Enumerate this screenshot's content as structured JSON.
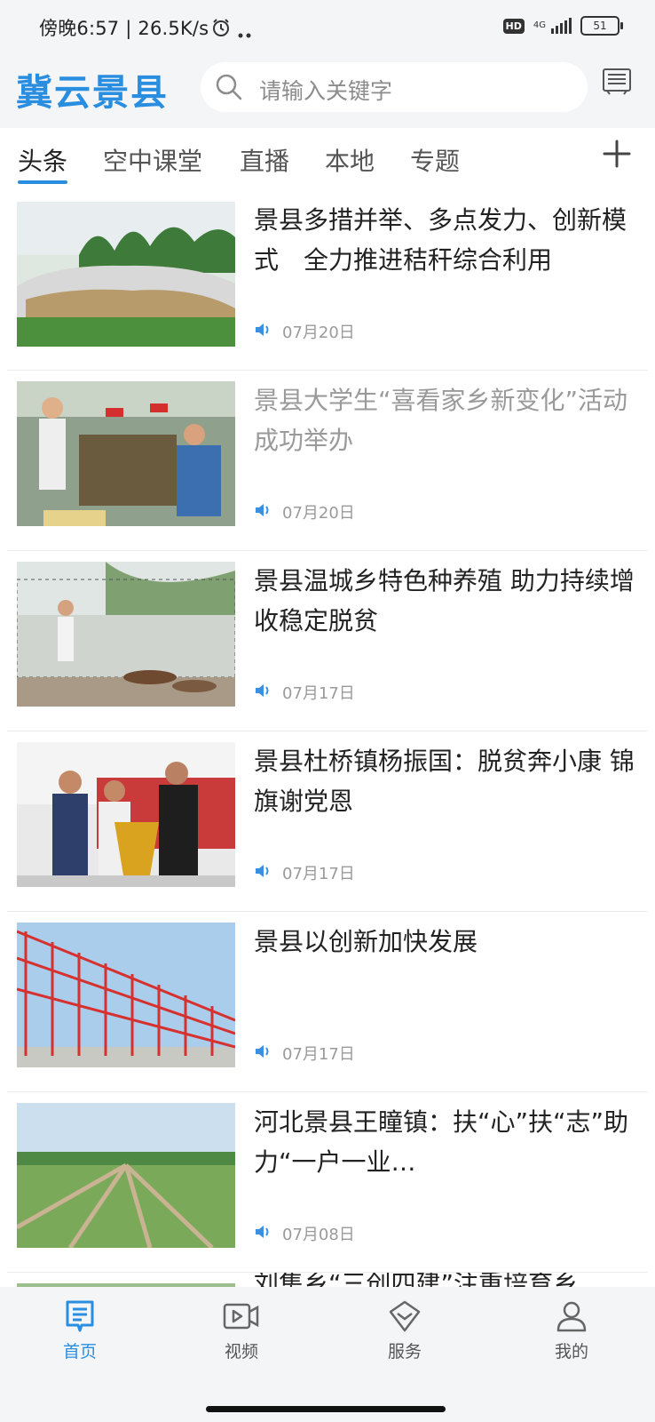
{
  "status_bar": {
    "time_text": "傍晚6:57 | 26.5K/s",
    "hd_label": "HD",
    "network_label": "4G",
    "battery_level": "51"
  },
  "header": {
    "app_title": "冀云景县",
    "search_placeholder": "请输入关键字"
  },
  "tabs": [
    {
      "label": "头条",
      "active": true
    },
    {
      "label": "空中课堂",
      "active": false
    },
    {
      "label": "直播",
      "active": false
    },
    {
      "label": "本地",
      "active": false
    },
    {
      "label": "专题",
      "active": false
    }
  ],
  "news": [
    {
      "title": "景县多措并举、多点发力、创新模式　全力推进秸秆综合利用",
      "date": "07月20日",
      "read": false
    },
    {
      "title": "景县大学生“喜看家乡新变化”活动成功举办",
      "date": "07月20日",
      "read": true
    },
    {
      "title": "景县温城乡特色种养殖 助力持续增收稳定脱贫",
      "date": "07月17日",
      "read": false
    },
    {
      "title": "景县杜桥镇杨振国：脱贫奔小康 锦旗谢党恩",
      "date": "07月17日",
      "read": false
    },
    {
      "title": "景县以创新加快发展",
      "date": "07月17日",
      "read": false
    },
    {
      "title": "河北景县王瞳镇：扶“心”扶“志”助力“一户一业…",
      "date": "07月08日",
      "read": false
    },
    {
      "title": "刘集乡“三创四建”注重培育乡",
      "date": "",
      "read": false
    }
  ],
  "bottom_nav": [
    {
      "label": "首页",
      "icon": "home-news-icon",
      "active": true
    },
    {
      "label": "视频",
      "icon": "video-icon",
      "active": false
    },
    {
      "label": "服务",
      "icon": "service-icon",
      "active": false
    },
    {
      "label": "我的",
      "icon": "profile-icon",
      "active": false
    }
  ],
  "colors": {
    "accent": "#2a8ee0",
    "read_text": "#9a9a9a",
    "header_bg": "#f4f5f7"
  }
}
